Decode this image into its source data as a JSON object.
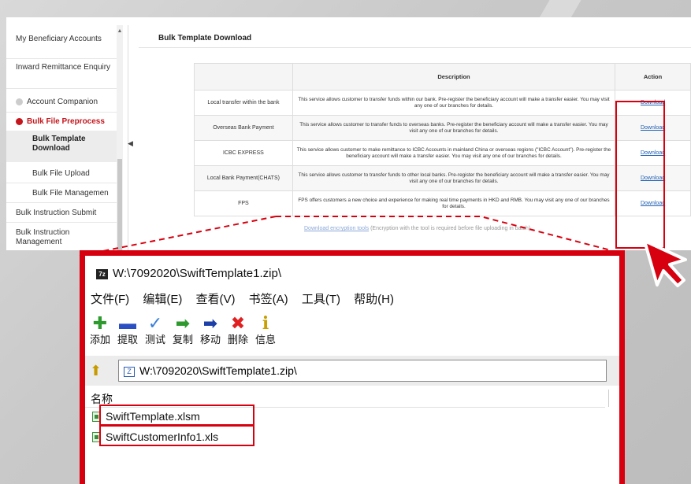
{
  "sidebar": {
    "items": [
      {
        "label": "My Beneficiary Accounts"
      },
      {
        "label": "Inward Remittance Enquiry"
      },
      {
        "label": "Account Companion"
      },
      {
        "label": "Bulk File Preprocess"
      },
      {
        "label": "Bulk Template Download"
      },
      {
        "label": "Bulk File Upload"
      },
      {
        "label": "Bulk File Managemen"
      },
      {
        "label": "Bulk Instruction Submit"
      },
      {
        "label": "Bulk Instruction Management"
      }
    ]
  },
  "main": {
    "title": "Bulk Template Download",
    "table": {
      "headers": [
        "",
        "Description",
        "Action"
      ],
      "rows": [
        {
          "type": "Local transfer within the bank",
          "description": "This service allows customer to transfer funds within our bank. Pre-register the beneficiary account will make a transfer easier. You may visit any one of our branches for details.",
          "action": "Download"
        },
        {
          "type": "Overseas Bank Payment",
          "description": "This service allows customer to transfer funds to overseas banks. Pre-register the beneficiary account will make a transfer easier. You may visit any one of our branches for details.",
          "action": "Download"
        },
        {
          "type": "ICBC EXPRESS",
          "description": "This service allows customer to make remittance to ICBC Accounts in mainland China or overseas regions (\"ICBC Account\"). Pre-register the beneficiary account will make a transfer easier. You may visit any one of our branches for details.",
          "action": "Download"
        },
        {
          "type": "Local Bank Payment(CHATS)",
          "description": "This service allows customer to transfer funds to other local banks. Pre-register the beneficiary account will make a transfer easier. You may visit any one of our branches for details.",
          "action": "Download"
        },
        {
          "type": "FPS",
          "description": "FPS offers customers a new choice and experience for making real time payments in HKD and RMB. You may visit any one of our branches for details.",
          "action": "Download"
        }
      ]
    },
    "encrypt_link": "Download encryption tools",
    "encrypt_note": "(Encryption with the tool is required before file uploading in batch)"
  },
  "zip_window": {
    "logo": "7z",
    "title": "W:\\7092020\\SwiftTemplate1.zip\\",
    "menu": [
      "文件(F)",
      "编辑(E)",
      "查看(V)",
      "书签(A)",
      "工具(T)",
      "帮助(H)"
    ],
    "toolbar": [
      {
        "label": "添加",
        "icon": "plus-icon",
        "glyph": "✚",
        "color": "#2e9a2e"
      },
      {
        "label": "提取",
        "icon": "minus-icon",
        "glyph": "▬",
        "color": "#2a4fc2"
      },
      {
        "label": "测试",
        "icon": "check-icon",
        "glyph": "✓",
        "color": "#3a7fd8"
      },
      {
        "label": "复制",
        "icon": "copy-arrows-icon",
        "glyph": "➡",
        "color": "#2e9a2e"
      },
      {
        "label": "移动",
        "icon": "move-arrow-icon",
        "glyph": "➡",
        "color": "#1c3fa8"
      },
      {
        "label": "删除",
        "icon": "delete-x-icon",
        "glyph": "✖",
        "color": "#e02020"
      },
      {
        "label": "信息",
        "icon": "info-icon",
        "glyph": "i",
        "color": "#c8a000"
      }
    ],
    "address": "W:\\7092020\\SwiftTemplate1.zip\\",
    "column_name": "名称",
    "files": [
      "SwiftTemplate.xlsm",
      "SwiftCustomerInfo1.xls"
    ]
  },
  "colors": {
    "highlight": "#d7000f",
    "link": "#1f5fb5",
    "brand_red": "#c4161c"
  }
}
